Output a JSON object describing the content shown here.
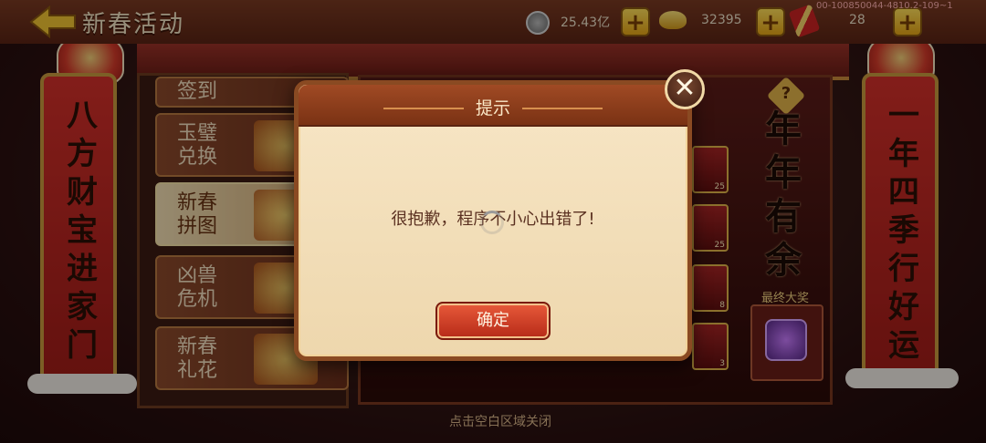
{
  "header": {
    "title": "新春活动",
    "silver_amount": "25.43亿",
    "gold_amount": "32395",
    "firecracker_amount": "28",
    "version": "00-100850044-4810.2-109~1"
  },
  "menu": {
    "items": [
      {
        "label_line1": "签到",
        "label_line2": ""
      },
      {
        "label_line1": "玉璧",
        "label_line2": "兑换"
      },
      {
        "label_line1": "新春",
        "label_line2": "拼图"
      },
      {
        "label_line1": "凶兽",
        "label_line2": "危机"
      },
      {
        "label_line1": "新春",
        "label_line2": "礼花"
      }
    ],
    "active_index": 2
  },
  "couplets": {
    "left": [
      "八",
      "方",
      "财",
      "宝",
      "进",
      "家",
      "门"
    ],
    "right": [
      "一",
      "年",
      "四",
      "季",
      "行",
      "好",
      "运"
    ]
  },
  "board": {
    "banner": [
      "年",
      "年",
      "有",
      "余"
    ],
    "banner_sub": "最终大奖",
    "slot_counts": [
      "25",
      "25",
      "8",
      "3"
    ]
  },
  "footer_hint": "点击空白区域关闭",
  "dialog": {
    "title": "提示",
    "message": "很抱歉，程序不小心出错了!",
    "ok_label": "确定",
    "close_symbol": "✕"
  }
}
